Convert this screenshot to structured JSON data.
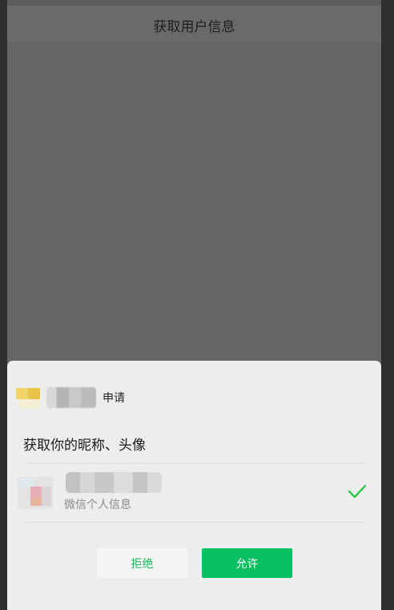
{
  "page": {
    "title": "获取用户信息"
  },
  "auth_sheet": {
    "apply_label": "申请",
    "scope_text": "获取你的昵称、头像",
    "account": {
      "label": "微信个人信息",
      "selected": true
    },
    "deny_label": "拒绝",
    "allow_label": "允许"
  },
  "colors": {
    "accent_green": "#07c160",
    "check_green": "#21c33a",
    "overlay": "#666666",
    "sheet_bg": "#ededed"
  },
  "icons": {
    "check": "check-icon"
  }
}
